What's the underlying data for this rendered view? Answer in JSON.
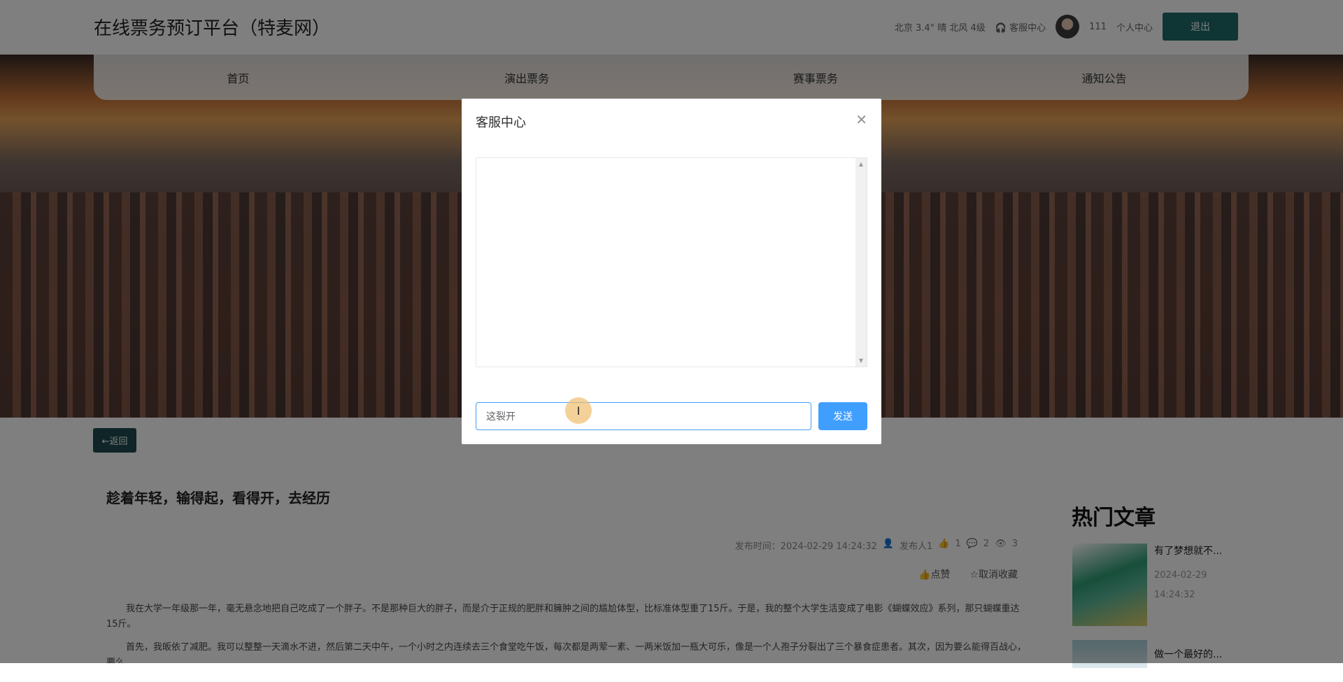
{
  "header": {
    "title": "在线票务预订平台（特麦网）",
    "weather": "北京  3.4°  晴  北风  4级",
    "service": "客服中心",
    "username": "111",
    "profile": "个人中心",
    "logout": "退出"
  },
  "nav": [
    "首页",
    "演出票务",
    "赛事票务",
    "通知公告"
  ],
  "back": "←返回",
  "article": {
    "title": "趁着年轻，输得起，看得开，去经历",
    "publish": "发布时间：2024-02-29 14:24:32",
    "author": "发布人1",
    "likes": "1",
    "comments": "2",
    "views": "3",
    "like_btn": "点赞",
    "fav_btn": "取消收藏",
    "p1": "我在大学一年级那一年，毫无悬念地把自己吃成了一个胖子。不是那种巨大的胖子，而是介于正规的肥胖和臃肿之间的尴尬体型，比标准体型重了15斤。于是，我的整个大学生活变成了电影《蝴蝶效应》系列，那只蝴蝶重达15斤。",
    "p2": "首先，我皈依了减肥。我可以整整一天滴水不进，然后第二天中午，一个小时之内连续去三个食堂吃午饭，每次都是两荤一素、一两米饭加一瓶大可乐，像是一个人孢子分裂出了三个暴食症患者。其次，因为要么能得百战心，要么……"
  },
  "sidebar": {
    "title": "热门文章",
    "items": [
      {
        "title": "有了梦想就不...",
        "date": "2024-02-29",
        "time": "14:24:32"
      },
      {
        "title": "做一个最好的..."
      }
    ]
  },
  "dialog": {
    "title": "客服中心",
    "input_value": "这裂开",
    "send": "发送"
  }
}
